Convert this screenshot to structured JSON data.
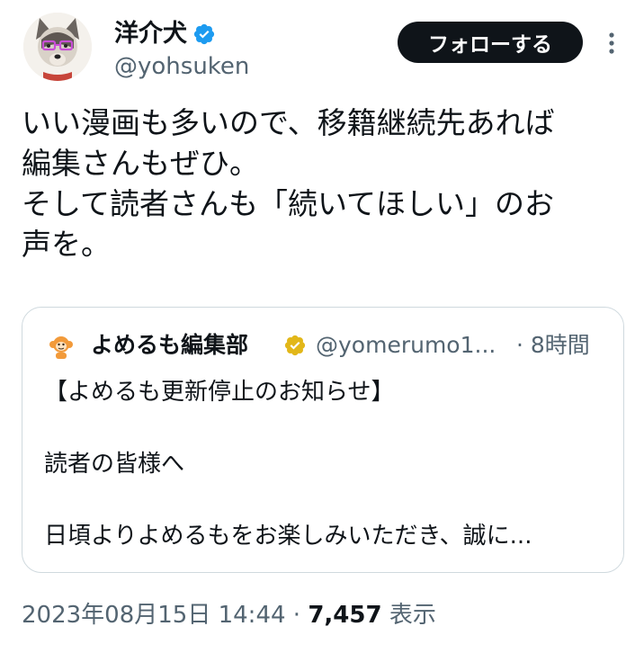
{
  "author": {
    "display_name": "洋介犬",
    "handle": "@yohsuken",
    "verified_icon": "verified-badge-blue",
    "verified_color": "#1d9bf0"
  },
  "follow_button": {
    "label": "フォローする"
  },
  "more_icon": "more-vertical-icon",
  "tweet_text": {
    "lines": [
      "いい漫画も多いので、移籍継続先あれば",
      "編集さんもぜひ。",
      "そして読者さんも「続いてほしい」のお",
      "声を。"
    ]
  },
  "quote": {
    "display_name": "よめるも編集部",
    "verified_icon": "verified-badge-gold",
    "verified_color": "#e2b719",
    "handle": "@yomerumo1...",
    "time": "· 8時間",
    "lines": [
      "【よめるも更新停止のお知らせ】",
      "",
      "読者の皆様へ",
      "",
      "日頃よりよめるもをお楽しみいただき、誠に..."
    ]
  },
  "meta": {
    "timestamp": "2023年08月15日 14:44",
    "separator": " · ",
    "views": "7,457",
    "views_label": " 表示"
  },
  "colors": {
    "text_primary": "#0f1419",
    "text_secondary": "#536471",
    "border": "#cfd9de",
    "follow_bg": "#0f1419"
  }
}
